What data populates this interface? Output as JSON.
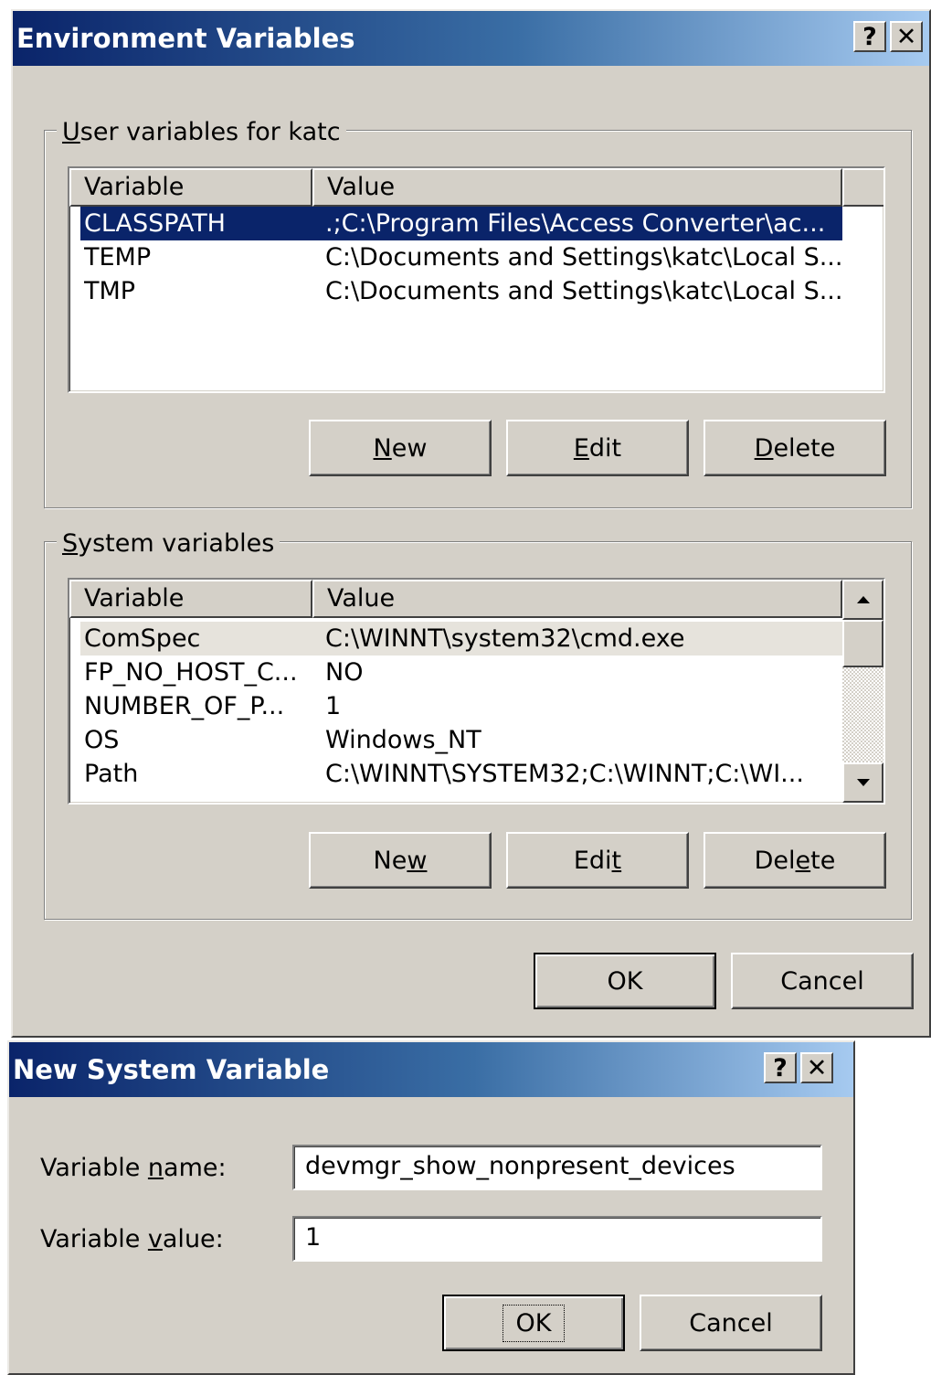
{
  "env_window": {
    "title": "Environment Variables",
    "help_glyph": "?",
    "close_glyph": "✕",
    "user_group": {
      "legend_pre": "",
      "legend_ul": "U",
      "legend_post": "ser variables for katc",
      "columns": [
        "Variable",
        "Value"
      ],
      "rows": [
        {
          "variable": "CLASSPATH",
          "value": ".;C:\\Program Files\\Access Converter\\ac...",
          "selected": true
        },
        {
          "variable": "TEMP",
          "value": "C:\\Documents and Settings\\katc\\Local S...",
          "selected": false
        },
        {
          "variable": "TMP",
          "value": "C:\\Documents and Settings\\katc\\Local S...",
          "selected": false
        }
      ],
      "buttons": {
        "new": {
          "pre": "",
          "ul": "N",
          "post": "ew"
        },
        "edit": {
          "pre": "",
          "ul": "E",
          "post": "dit"
        },
        "delete": {
          "pre": "",
          "ul": "D",
          "post": "elete"
        }
      }
    },
    "system_group": {
      "legend_pre": "",
      "legend_ul": "S",
      "legend_post": "ystem variables",
      "columns": [
        "Variable",
        "Value"
      ],
      "rows": [
        {
          "variable": "ComSpec",
          "value": "C:\\WINNT\\system32\\cmd.exe",
          "selected": true
        },
        {
          "variable": "FP_NO_HOST_C...",
          "value": "NO",
          "selected": false
        },
        {
          "variable": "NUMBER_OF_P...",
          "value": "1",
          "selected": false
        },
        {
          "variable": "OS",
          "value": "Windows_NT",
          "selected": false
        },
        {
          "variable": "Path",
          "value": "C:\\WINNT\\SYSTEM32;C:\\WINNT;C:\\WI...",
          "selected": false
        }
      ],
      "buttons": {
        "new": {
          "pre": "Ne",
          "ul": "w",
          "post": ""
        },
        "edit": {
          "pre": "Edi",
          "ul": "t",
          "post": ""
        },
        "delete": {
          "pre": "Del",
          "ul": "e",
          "post": "te"
        }
      }
    },
    "ok": "OK",
    "cancel": "Cancel"
  },
  "new_var_window": {
    "title": "New System Variable",
    "help_glyph": "?",
    "close_glyph": "✕",
    "name_label": {
      "pre": "Variable ",
      "ul": "n",
      "post": "ame:"
    },
    "value_label": {
      "pre": "Variable ",
      "ul": "v",
      "post": "alue:"
    },
    "name_value": "devmgr_show_nonpresent_devices",
    "value_value": "1",
    "ok": "OK",
    "cancel": "Cancel"
  }
}
